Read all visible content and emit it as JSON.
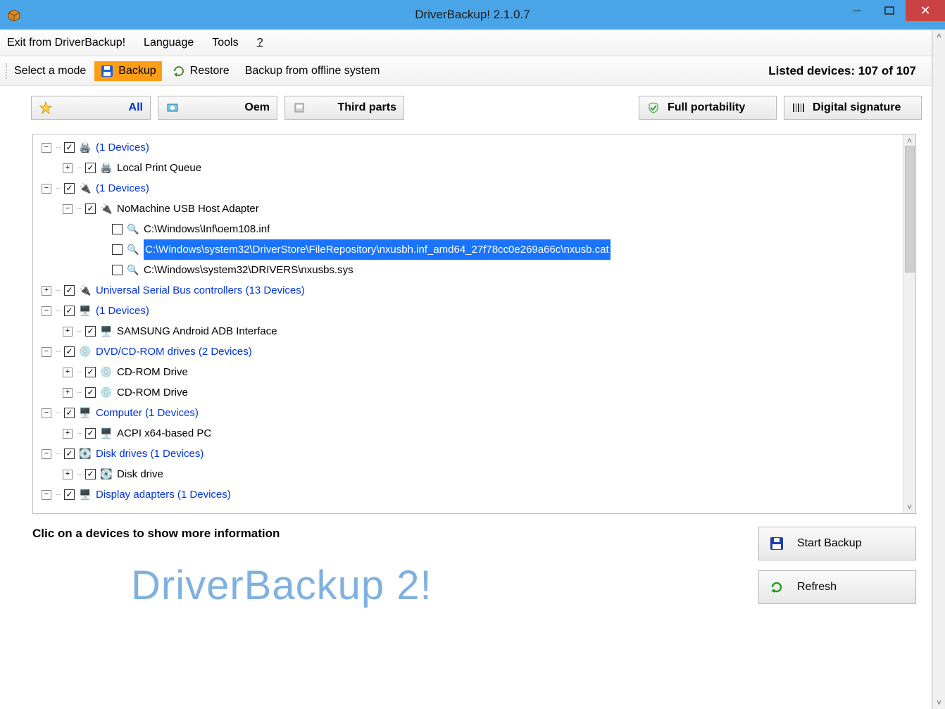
{
  "window": {
    "title": "DriverBackup! 2.1.0.7"
  },
  "menubar": {
    "exit": "Exit from DriverBackup!",
    "language": "Language",
    "tools": "Tools",
    "help": "?"
  },
  "modebar": {
    "select_label": "Select a mode",
    "backup": "Backup",
    "restore": "Restore",
    "offline": "Backup from offline system",
    "listed": "Listed devices: 107 of 107"
  },
  "filters": {
    "all": "All",
    "oem": "Oem",
    "third": "Third parts",
    "portability": "Full portability",
    "signature": "Digital signature"
  },
  "tree": {
    "cat_print": "(1 Devices)",
    "local_print_queue": "Local Print Queue",
    "cat_usb_adapter": "(1 Devices)",
    "nomachine": "NoMachine USB Host Adapter",
    "file_inf": "C:\\Windows\\Inf\\oem108.inf",
    "file_cat": "C:\\Windows\\system32\\DriverStore\\FileRepository\\nxusbh.inf_amd64_27f78cc0e269a66c\\nxusb.cat",
    "file_sys": "C:\\Windows\\system32\\DRIVERS\\nxusbs.sys",
    "cat_usbctrl": "Universal Serial Bus controllers   (13 Devices)",
    "cat_adb": "(1 Devices)",
    "samsung_adb": "SAMSUNG Android ADB Interface",
    "cat_dvd": "DVD/CD-ROM drives   (2 Devices)",
    "cdrom1": "CD-ROM Drive",
    "cdrom2": "CD-ROM Drive",
    "cat_computer": "Computer   (1 Devices)",
    "acpi": "ACPI x64-based PC",
    "cat_disk": "Disk drives   (1 Devices)",
    "diskdrive": "Disk drive",
    "cat_display": "Display adapters   (1 Devices)"
  },
  "bottom": {
    "hint": "Clic on a devices to show more information",
    "brand": "DriverBackup 2!",
    "start_backup": "Start Backup",
    "refresh": "Refresh"
  }
}
